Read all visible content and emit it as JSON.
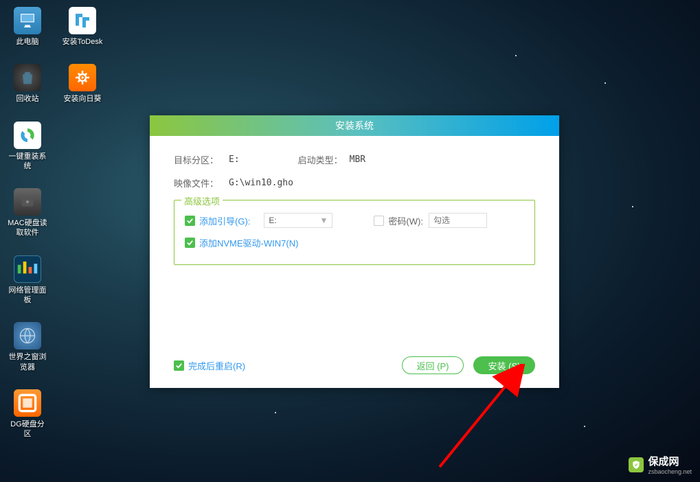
{
  "desktop": {
    "icons": [
      {
        "label": "此电脑"
      },
      {
        "label": "安装ToDesk"
      },
      {
        "label": "回收站"
      },
      {
        "label": "安装向日葵"
      },
      {
        "label": "一键重装系统"
      },
      {
        "label": "MAC硬盘读取软件"
      },
      {
        "label": "网络管理面板"
      },
      {
        "label": "世界之窗浏览器"
      },
      {
        "label": "DG硬盘分区"
      }
    ]
  },
  "dialog": {
    "title": "安装系统",
    "target_partition_label": "目标分区：",
    "target_partition_value": "E:",
    "boot_type_label": "启动类型：",
    "boot_type_value": "MBR",
    "image_file_label": "映像文件：",
    "image_file_value": "G:\\win10.gho",
    "advanced": {
      "legend": "高级选项",
      "add_boot_label": "添加引导(G):",
      "add_boot_value": "E:",
      "password_label": "密码(W):",
      "password_placeholder": "勾选",
      "nvme_label": "添加NVME驱动-WIN7(N)"
    },
    "restart_label": "完成后重启(R)",
    "back_btn": "返回 (P)",
    "install_btn": "安装 (S)"
  },
  "watermark": {
    "title": "保成网",
    "url": "zsbaocheng.net"
  }
}
